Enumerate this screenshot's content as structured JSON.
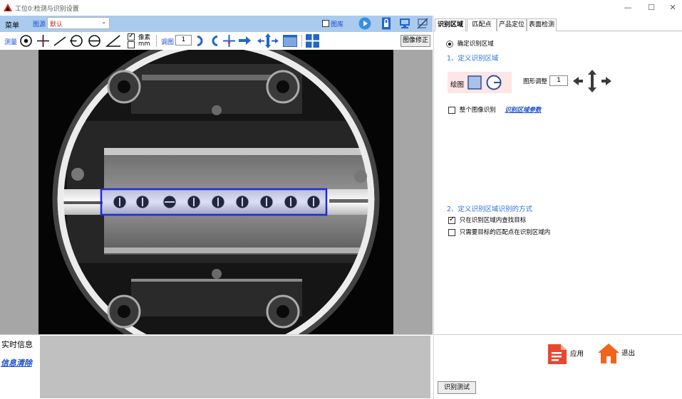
{
  "window": {
    "title": "工位0:检测与识别设置",
    "minimize": "—",
    "maximize": "☐",
    "close": "✕"
  },
  "menubar": {
    "menu_label": "菜单",
    "image_source_label": "图源",
    "image_source_value": "默认",
    "gallery_label": "图库",
    "gallery_checked": false
  },
  "toolbar": {
    "measure_label": "测量",
    "unit_pixel_label": "像素",
    "unit_pixel_checked": true,
    "unit_mm_label": "mm",
    "unit_mm_checked": false,
    "adjust_label": "调图",
    "adjust_value": "1",
    "image_fix_label": "图像修正"
  },
  "info": {
    "title": "实时信息",
    "clear_label": "信息清除"
  },
  "tabs": [
    {
      "label": "识别区域",
      "active": true
    },
    {
      "label": "匹配点",
      "active": false
    },
    {
      "label": "产品定位",
      "active": false
    },
    {
      "label": "表面检测",
      "active": false
    }
  ],
  "region": {
    "radio_label": "确定识别区域",
    "radio_selected": true,
    "section1_title": "1、定义识别区域",
    "draw_label": "绘图",
    "shape_adjust_label": "图形调整",
    "shape_adjust_value": "1",
    "whole_image_label": "整个图像识别",
    "whole_image_checked": false,
    "region_params_link": "识别区域参数",
    "section2_title": "2、定义识别区域识别的方式",
    "option_find_in_region": "只在识别区域内查找目标",
    "option_find_in_region_checked": true,
    "option_match_in_region": "只需要目标的匹配点在识别区域内",
    "option_match_in_region_checked": false
  },
  "actions": {
    "apply_label": "应用",
    "exit_label": "退出",
    "test_label": "识别测试"
  },
  "colors": {
    "accent_blue": "#1a4fd0",
    "menu_bar_bg": "#aacbee",
    "section_title": "#2b6ed8",
    "draw_panel_bg": "#fde6e6",
    "apply_icon": "#e8472e",
    "exit_icon": "#f06420",
    "roi_rect": "#1c2bd8"
  }
}
